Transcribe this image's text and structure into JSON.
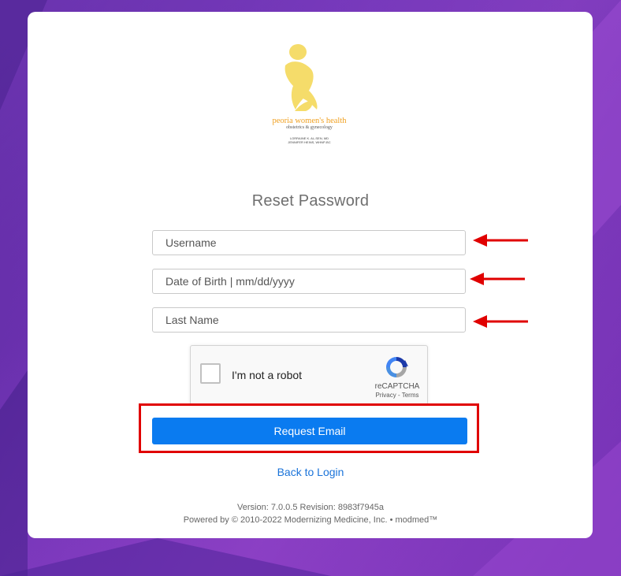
{
  "logo": {
    "name": "peoria women's health",
    "subtitle": "obstetrics & gynecology",
    "doctors": [
      "LORRAINE K. AL-SEN, MD",
      "JENNIFER HEINS, WHNP-BC"
    ],
    "color": "#f5dc6a"
  },
  "page": {
    "title": "Reset Password"
  },
  "form": {
    "username_placeholder": "Username",
    "dob_placeholder": "Date of Birth | mm/dd/yyyy",
    "lastname_placeholder": "Last Name"
  },
  "captcha": {
    "label": "I'm not a robot",
    "brand": "reCAPTCHA",
    "privacy": "Privacy",
    "separator": " - ",
    "terms": "Terms"
  },
  "actions": {
    "request_email": "Request Email",
    "back_to_login": "Back to Login"
  },
  "footer": {
    "version": "Version: 7.0.0.5 Revision: 8983f7945a",
    "powered": "Powered by © 2010-2022 Modernizing Medicine, Inc. • modmed™"
  },
  "colors": {
    "accent": "#0a7bf0",
    "annotation": "#e00000",
    "link": "#1a73d9"
  },
  "annotations": {
    "arrow_icon": "left-arrow-icon",
    "highlight": "red-box"
  }
}
